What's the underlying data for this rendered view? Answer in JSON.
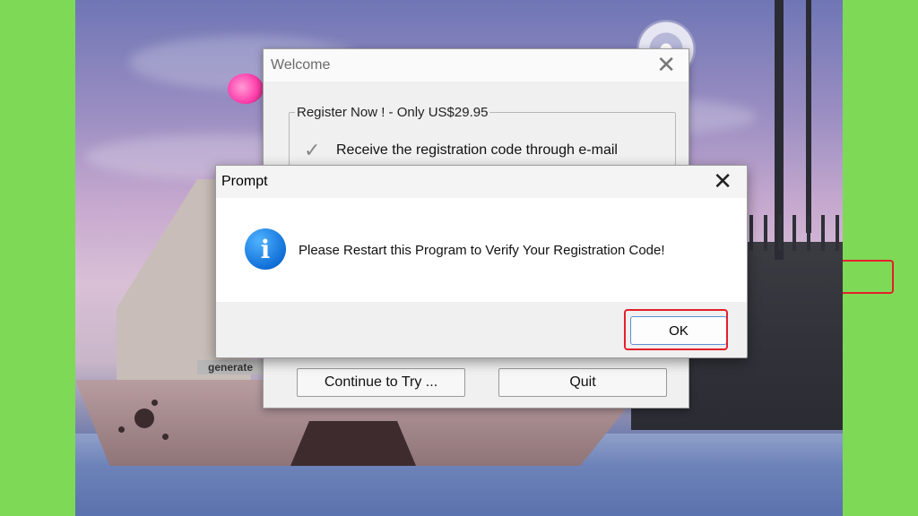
{
  "welcome": {
    "title": "Welcome",
    "close_glyph": "✕",
    "group_label": "Register Now ! - Only US$29.95",
    "option_label": "Receive the registration code through e-mail",
    "continue_button": "Continue to Try ...",
    "quit_button": "Quit"
  },
  "prompt": {
    "title": "Prompt",
    "close_glyph": "✕",
    "icon_glyph": "i",
    "message": "Please Restart this Program to Verify Your Registration Code!",
    "ok_button": "OK"
  },
  "background": {
    "skin_text": "generate"
  },
  "colors": {
    "frame": "#7ed957",
    "highlight": "#e3202a",
    "info_icon": "#1170d8"
  }
}
